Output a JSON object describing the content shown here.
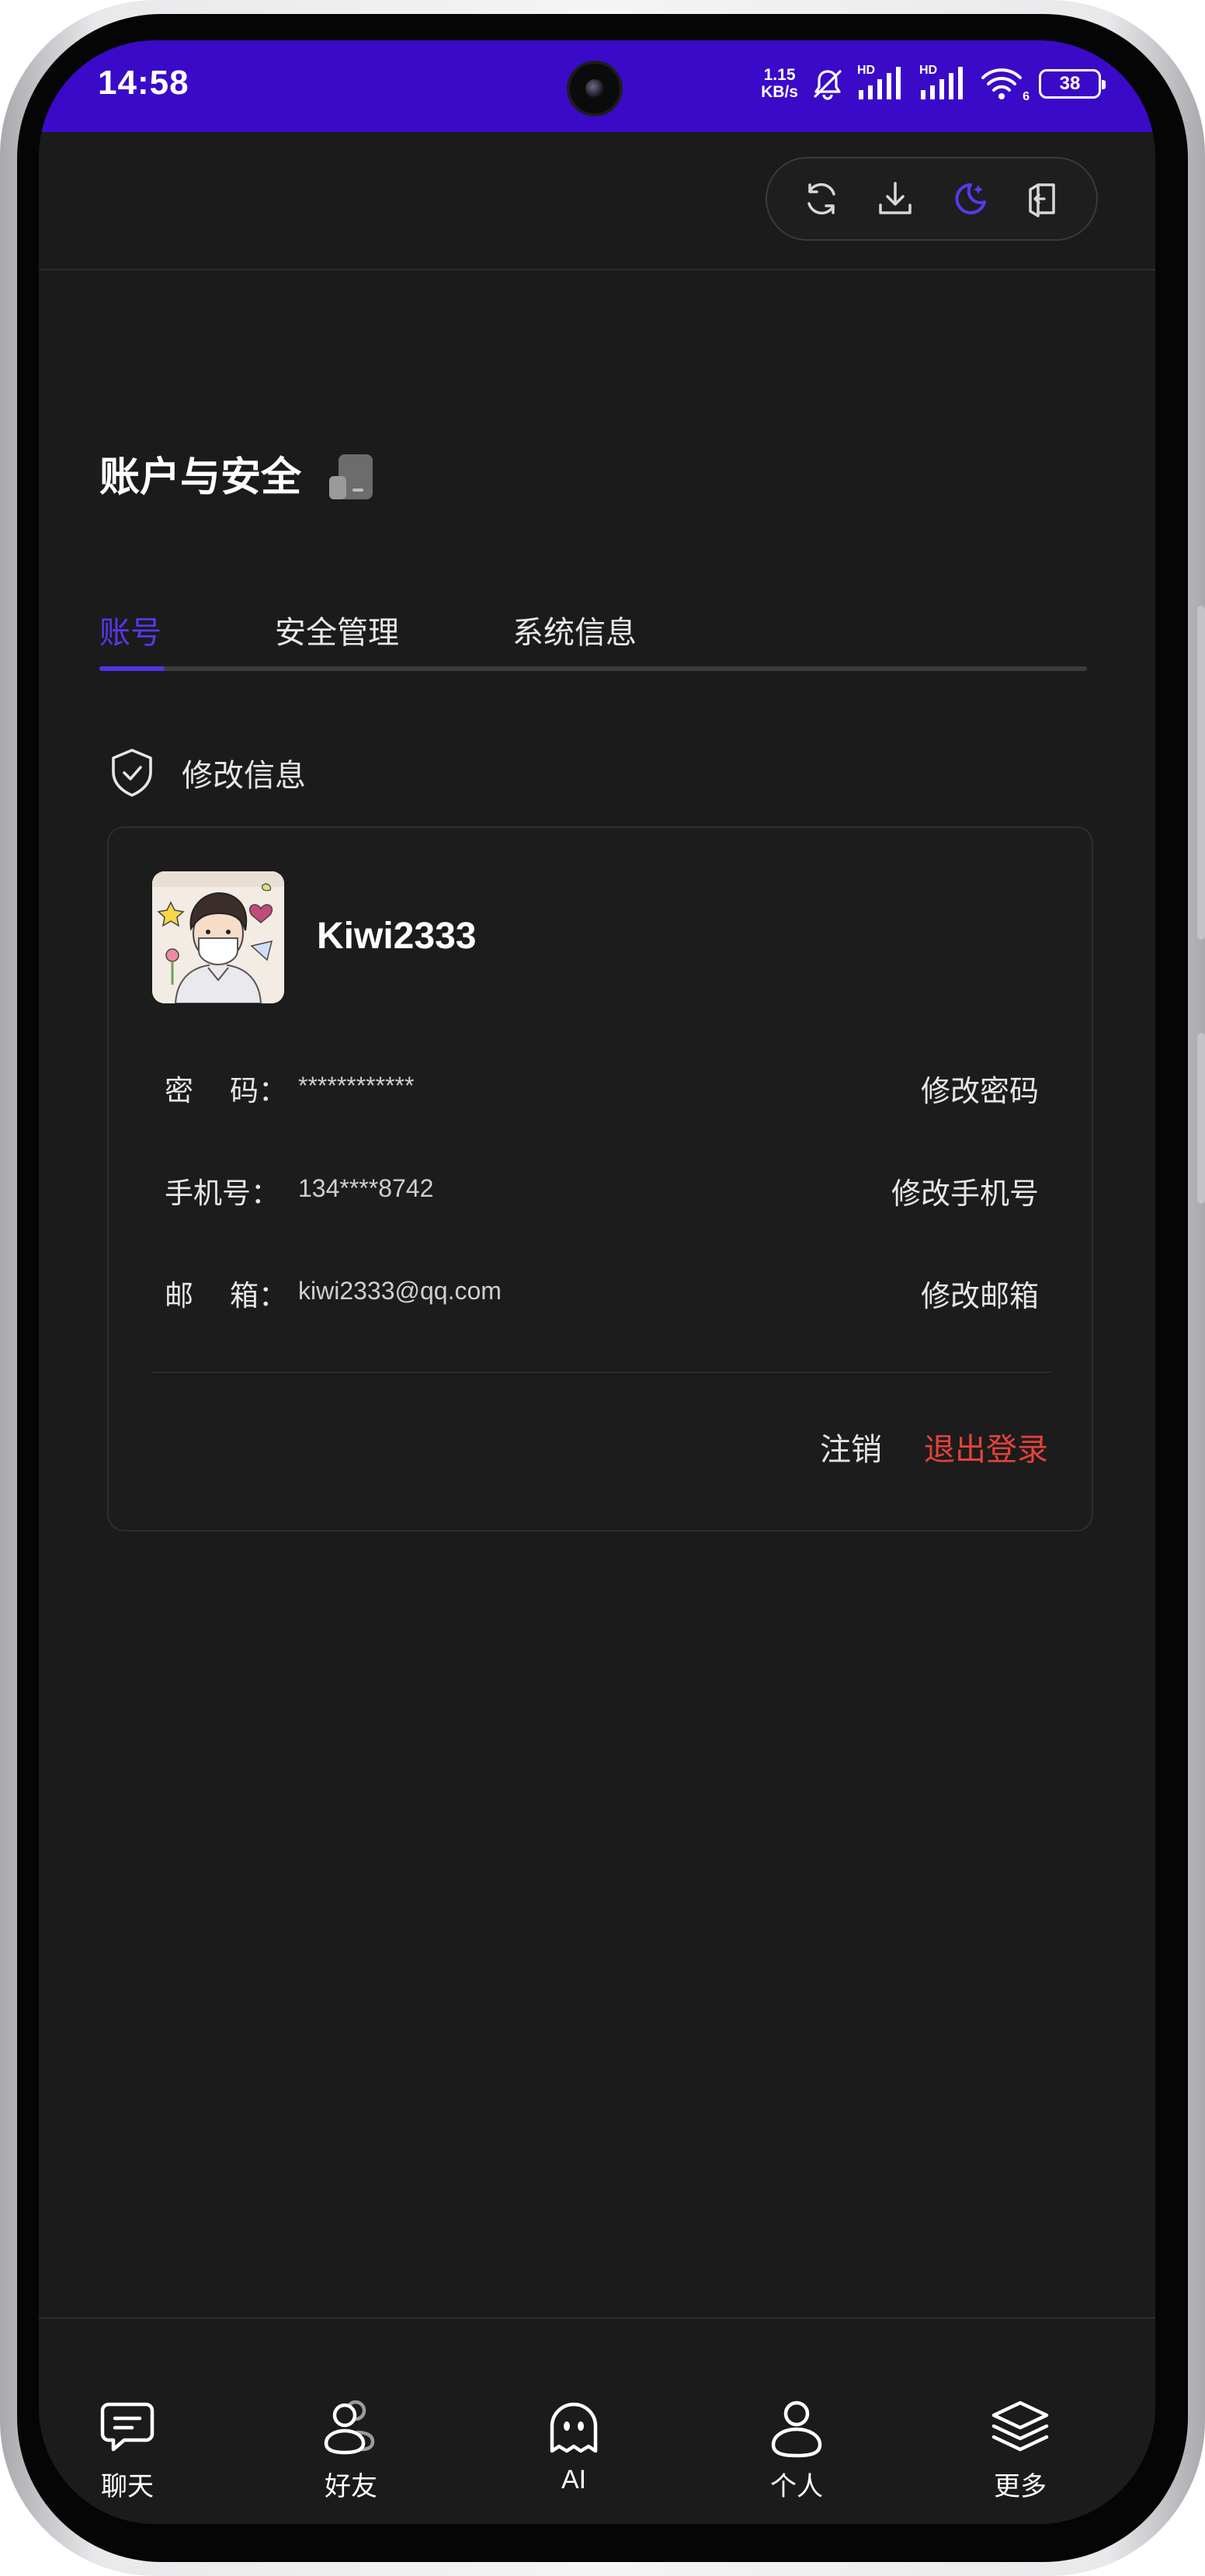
{
  "status_bar": {
    "time": "14:58",
    "net_speed_value": "1.15",
    "net_speed_unit": "KB/s",
    "signal_label_1": "HD",
    "signal_label_2": "HD",
    "wifi_label": "6",
    "battery_level": "38",
    "background_color": "#3a0ac8"
  },
  "toolbar": {
    "icons": [
      "refresh-icon",
      "download-icon",
      "moon-icon",
      "exit-icon"
    ],
    "active_color": "#5a37ee"
  },
  "page": {
    "title": "账户与安全"
  },
  "tabs": [
    {
      "label": "账号",
      "active": true
    },
    {
      "label": "安全管理",
      "active": false
    },
    {
      "label": "系统信息",
      "active": false
    }
  ],
  "section": {
    "title": "修改信息",
    "icon": "shield-check-icon"
  },
  "account": {
    "username": "Kiwi2333",
    "rows": [
      {
        "label": "密    码：",
        "value": "************",
        "action": "修改密码"
      },
      {
        "label": "手机号：",
        "value": "134****8742",
        "action": "修改手机号"
      },
      {
        "label": "邮    箱：",
        "value": "kiwi2333@qq.com",
        "action": "修改邮箱"
      }
    ],
    "cancel_label": "注销",
    "logout_label": "退出登录",
    "logout_color": "#e5413b"
  },
  "bottom_nav": [
    {
      "label": "聊天",
      "icon": "chat-icon"
    },
    {
      "label": "好友",
      "icon": "friends-icon"
    },
    {
      "label": "AI",
      "icon": "ghost-icon"
    },
    {
      "label": "个人",
      "icon": "user-icon"
    },
    {
      "label": "更多",
      "icon": "layers-icon"
    }
  ]
}
